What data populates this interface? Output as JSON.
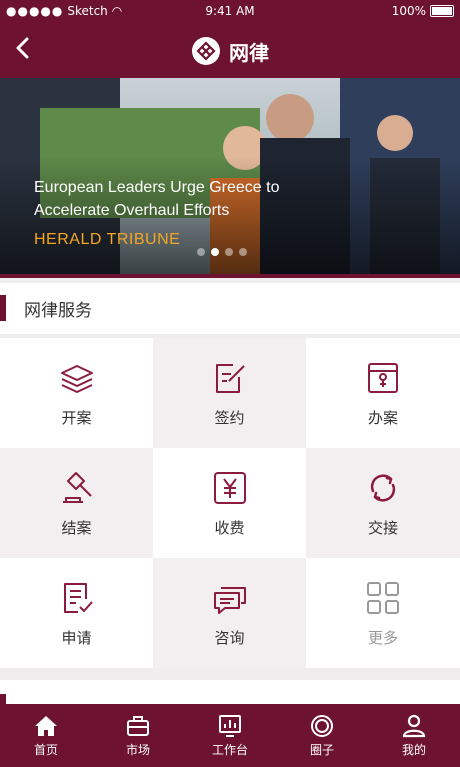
{
  "status_bar": {
    "carrier": "Sketch",
    "time": "9:41 AM",
    "battery": "100%"
  },
  "nav": {
    "title": "网律"
  },
  "banner": {
    "caption": "European Leaders Urge Greece to Accelerate Overhaul Efforts",
    "source": "HERALD TRIBUNE",
    "active_page": 2,
    "page_count": 4
  },
  "section": {
    "title": "网律服务"
  },
  "services": [
    {
      "label": "开案",
      "icon": "layers-icon"
    },
    {
      "label": "签约",
      "icon": "sign-icon"
    },
    {
      "label": "办案",
      "icon": "folder-icon"
    },
    {
      "label": "结案",
      "icon": "gavel-icon"
    },
    {
      "label": "收费",
      "icon": "yuan-icon"
    },
    {
      "label": "交接",
      "icon": "sync-icon"
    },
    {
      "label": "申请",
      "icon": "application-icon"
    },
    {
      "label": "咨询",
      "icon": "chat-icon"
    },
    {
      "label": "更多",
      "icon": "grid-icon"
    }
  ],
  "tabs": [
    {
      "label": "首页",
      "icon": "home-icon"
    },
    {
      "label": "市场",
      "icon": "briefcase-icon"
    },
    {
      "label": "工作台",
      "icon": "chart-icon"
    },
    {
      "label": "圈子",
      "icon": "circle-icon"
    },
    {
      "label": "我的",
      "icon": "user-icon"
    }
  ],
  "colors": {
    "brand": "#6d1230",
    "accent": "#f5a623"
  }
}
